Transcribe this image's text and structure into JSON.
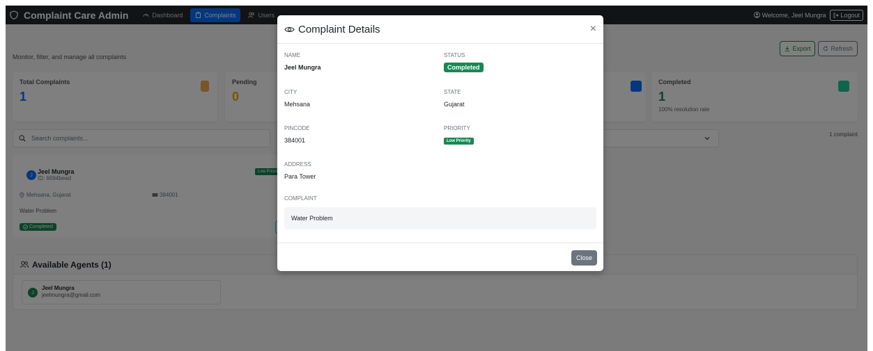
{
  "navbar": {
    "brand": "Complaint Care Admin",
    "links": [
      {
        "label": "Dashboard"
      },
      {
        "label": "Complaints"
      },
      {
        "label": "Users"
      }
    ],
    "welcome": "Welcome, Jeel Mungra",
    "logout": "Logout"
  },
  "header": {
    "subtitle": "Monitor, filter, and manage all complaints",
    "export": "Export",
    "refresh": "Refresh"
  },
  "stats": [
    {
      "label": "Total Complaints",
      "value": "1",
      "color": "#0d6efd"
    },
    {
      "label": "Pending",
      "value": "0",
      "color": "#f0ad00"
    },
    {
      "label": "Completed",
      "value": "1",
      "sub": "100% resolution rate",
      "color": "#198754"
    }
  ],
  "search": {
    "placeholder": "Search complaints..."
  },
  "results_count": "1 complaint",
  "complaint_card": {
    "avatar": "J",
    "name": "Jeel Mungra",
    "id": "ID: 6694bead",
    "priority": "Low Priority",
    "location": "Mehsana, Gujarat",
    "pincode": "384001",
    "description": "Water Problem",
    "status": "Completed"
  },
  "agents": {
    "title": "Available Agents (1)",
    "list": [
      {
        "avatar": "J",
        "name": "Jeel Mungra",
        "email": "jeelmungra@gmail.com"
      }
    ]
  },
  "modal": {
    "title": "Complaint Details",
    "close_symbol": "×",
    "fields": {
      "name_label": "NAME",
      "name": "Jeel Mungra",
      "status_label": "STATUS",
      "status": "Completed",
      "city_label": "CITY",
      "city": "Mehsana",
      "state_label": "STATE",
      "state": "Gujarat",
      "pincode_label": "PINCODE",
      "pincode": "384001",
      "priority_label": "PRIORITY",
      "priority": "Low Priority",
      "address_label": "ADDRESS",
      "address": "Para Tower",
      "complaint_label": "COMPLAINT",
      "complaint": "Water Problem"
    },
    "close_button": "Close"
  },
  "colors": {
    "navbar": "#23272b",
    "primary": "#0d6efd",
    "success": "#198754",
    "warning": "#f0ad00",
    "secondary": "#6c757d"
  }
}
